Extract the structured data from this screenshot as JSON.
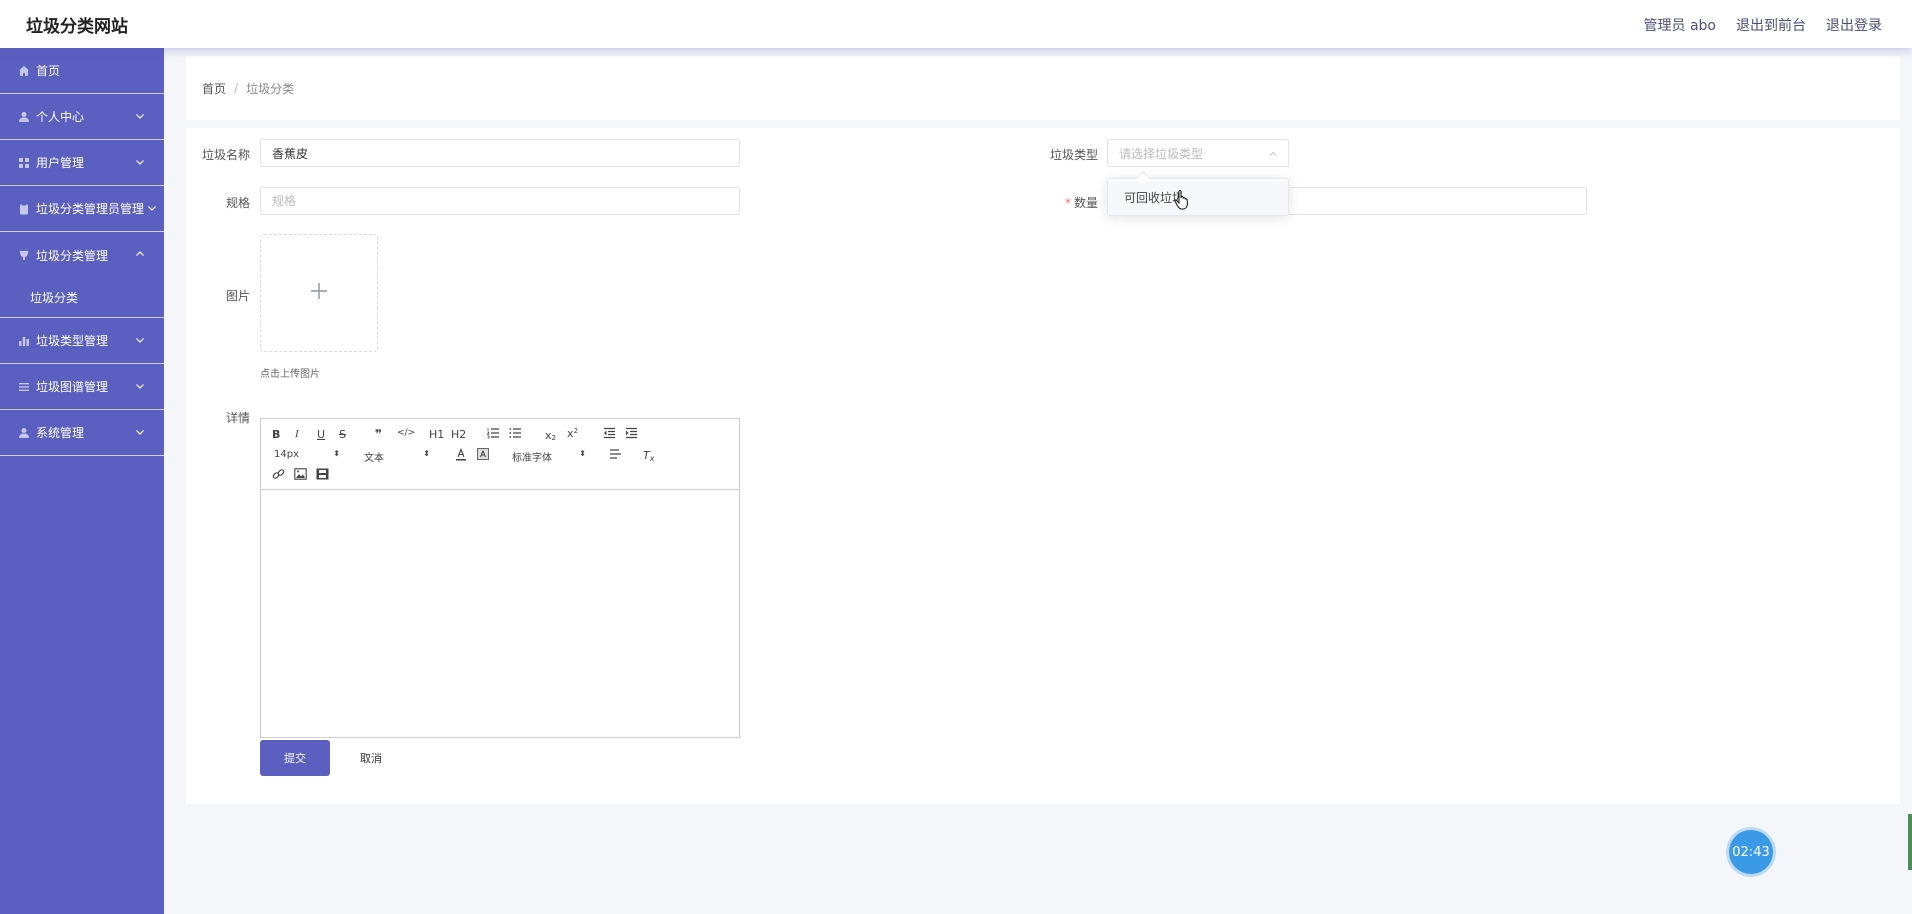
{
  "header": {
    "site_title": "垃圾分类网站",
    "admin_label": "管理员 abo",
    "to_front": "退出到前台",
    "logout": "退出登录"
  },
  "sidebar": {
    "items": [
      {
        "label": "首页",
        "icon": "home-icon"
      },
      {
        "label": "个人中心",
        "icon": "user-icon"
      },
      {
        "label": "用户管理",
        "icon": "grid-icon"
      },
      {
        "label": "垃圾分类管理员管理",
        "icon": "clipboard-icon"
      },
      {
        "label": "垃圾分类管理",
        "icon": "trash-icon",
        "expanded": true,
        "children": [
          {
            "label": "垃圾分类"
          }
        ]
      },
      {
        "label": "垃圾类型管理",
        "icon": "bar-chart-icon"
      },
      {
        "label": "垃圾图谱管理",
        "icon": "list-icon"
      },
      {
        "label": "系统管理",
        "icon": "user-icon"
      }
    ]
  },
  "breadcrumb": {
    "home": "首页",
    "separator": "/",
    "current": "垃圾分类"
  },
  "form": {
    "name_label": "垃圾名称",
    "name_value": "香蕉皮",
    "type_label": "垃圾类型",
    "type_placeholder": "请选择垃圾类型",
    "type_options": [
      "可回收垃圾"
    ],
    "spec_label": "规格",
    "spec_placeholder": "规格",
    "qty_required_mark": "*",
    "qty_label": "数量",
    "qty_value": "",
    "image_label": "图片",
    "upload_tip": "点击上传图片",
    "detail_label": "详情",
    "submit_label": "提交",
    "cancel_label": "取消"
  },
  "editor": {
    "font_size": "14px",
    "heading_select": "文本",
    "font_family": "标准字体",
    "h1": "H1",
    "h2": "H2"
  },
  "timer": "02:43"
}
